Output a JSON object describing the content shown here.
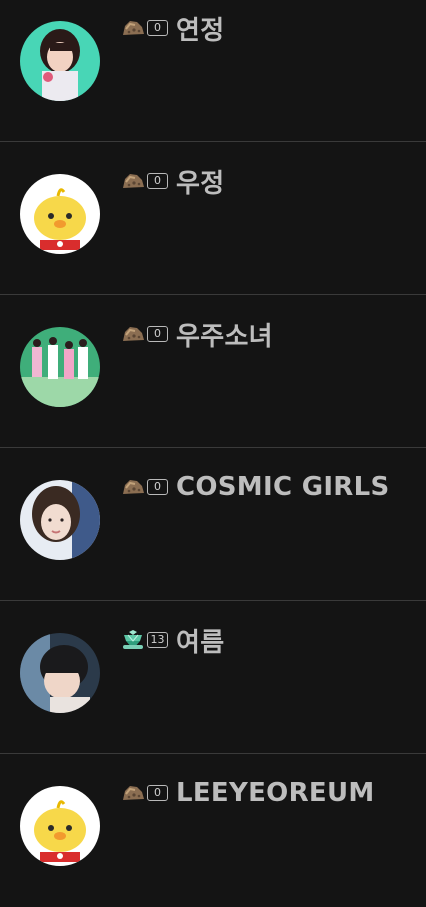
{
  "users": [
    {
      "nickname": "연정",
      "level": "0",
      "badge": "rock-level-icon",
      "avatar": "photo-avatar"
    },
    {
      "nickname": "우정",
      "level": "0",
      "badge": "rock-level-icon",
      "avatar": "chick-avatar"
    },
    {
      "nickname": "우주소녀",
      "level": "0",
      "badge": "rock-level-icon",
      "avatar": "photo-avatar"
    },
    {
      "nickname": "COSMIC GIRLS",
      "level": "0",
      "badge": "rock-level-icon",
      "avatar": "photo-avatar"
    },
    {
      "nickname": "여름",
      "level": "13",
      "badge": "emerald-level-icon",
      "avatar": "photo-avatar"
    },
    {
      "nickname": "LEEYEOREUM",
      "level": "0",
      "badge": "rock-level-icon",
      "avatar": "chick-avatar"
    }
  ],
  "colors": {
    "background": "#141414",
    "divider": "#3a3a3a",
    "nickname": "#bdbdbd",
    "level_border": "#b9b9b9"
  }
}
